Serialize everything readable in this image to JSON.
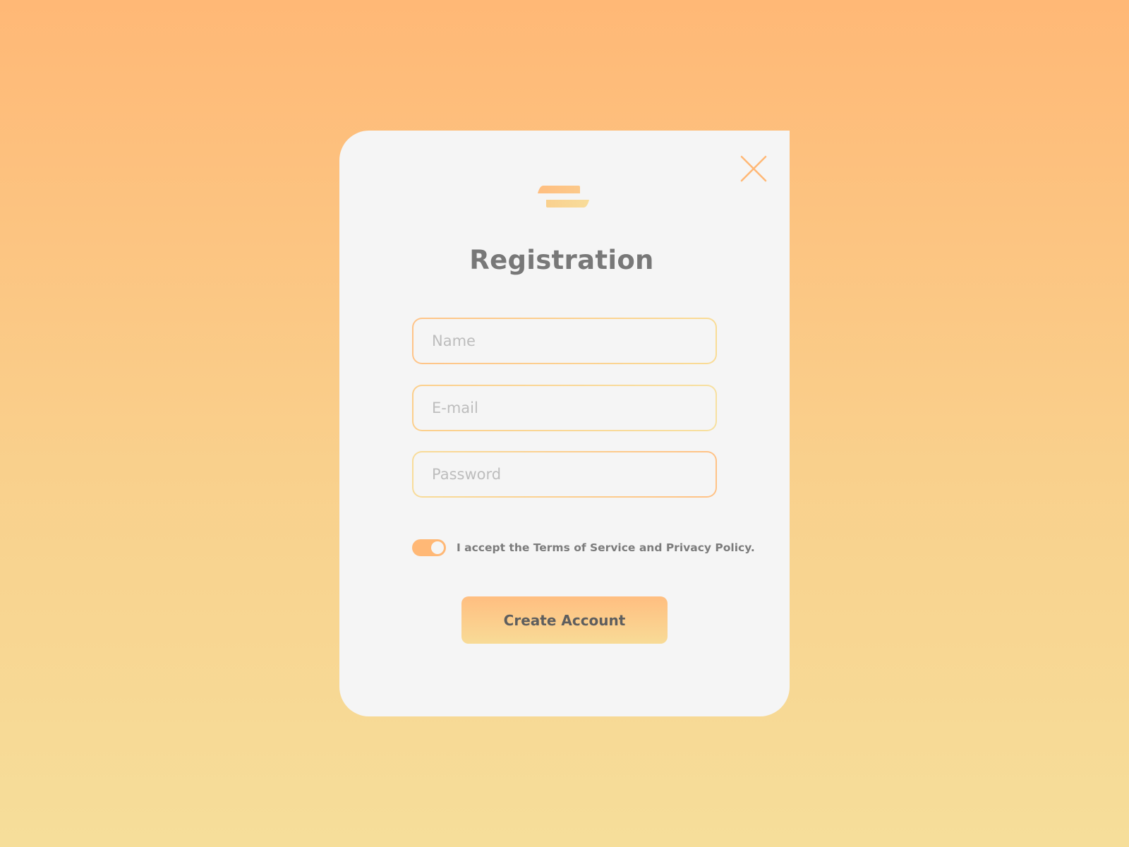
{
  "dialog": {
    "title": "Registration",
    "close_icon": "close-icon",
    "logo_icon": "brand-logo-icon"
  },
  "form": {
    "name": {
      "value": "",
      "placeholder": "Name"
    },
    "email": {
      "value": "",
      "placeholder": "E-mail"
    },
    "password": {
      "value": "",
      "placeholder": "Password"
    },
    "consent": {
      "checked": true,
      "label": "I accept the Terms of Service and Privacy Policy."
    },
    "submit_label": "Create Account"
  },
  "colors": {
    "accent": "#FFB876",
    "accent_light": "#F8DB97",
    "card_background": "#F5F5F5",
    "title_text": "#787878"
  }
}
